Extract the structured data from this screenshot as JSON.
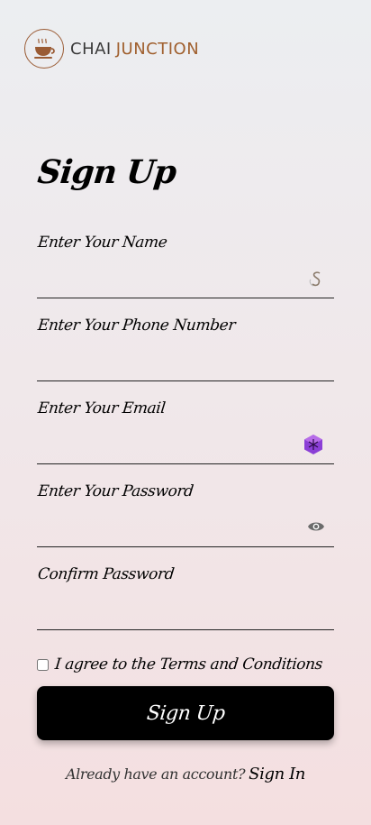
{
  "brand": {
    "word1": "CHAI",
    "word2": "JUNCTION",
    "logo_icon": "coffee-cup-icon"
  },
  "page_title": "Sign Up",
  "fields": [
    {
      "label": "Enter Your Name",
      "value": "",
      "icon": "grammarly-s-icon"
    },
    {
      "label": "Enter Your Phone Number",
      "value": ""
    },
    {
      "label": "Enter Your Email",
      "value": "",
      "icon": "extension-cube-icon"
    },
    {
      "label": "Enter Your Password",
      "value": "",
      "icon": "eye-icon"
    },
    {
      "label": "Confirm Password",
      "value": ""
    }
  ],
  "terms_label": "I agree to the Terms and Conditions",
  "submit_label": "Sign Up",
  "footer": {
    "question": "Already have an account?",
    "link": "Sign In"
  },
  "colors": {
    "brand_brown": "#a0602f",
    "button_bg": "#000000",
    "extension_purple": "#8b3fd6"
  }
}
